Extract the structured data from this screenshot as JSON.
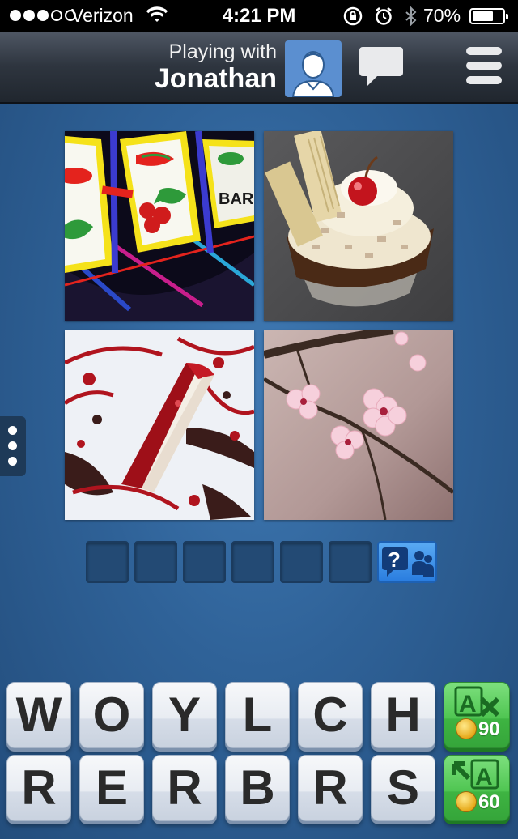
{
  "status_bar": {
    "carrier": "Verizon",
    "signal_bars_filled": 3,
    "signal_bars_total": 5,
    "time": "4:21 PM",
    "battery_percent": "70%",
    "battery_level": 0.7
  },
  "header": {
    "playing_with_label": "Playing with",
    "player_name": "Jonathan",
    "icons": [
      "avatar",
      "chat-icon",
      "menu-icon"
    ]
  },
  "puzzle": {
    "pictures": [
      {
        "subject": "slot-machine",
        "colors": [
          "#0c0a1a",
          "#f5e21a",
          "#e4231d",
          "#2e9a3a"
        ]
      },
      {
        "subject": "ice-cream-sundae",
        "colors": [
          "#4e4e50",
          "#efe6cf",
          "#c3141d",
          "#4a2a16"
        ]
      },
      {
        "subject": "cheesecake-slice",
        "colors": [
          "#f2f4f8",
          "#b0141e",
          "#3a1c1a"
        ]
      },
      {
        "subject": "cherry-blossom-branch",
        "colors": [
          "#b9a2a0",
          "#f6d0dc",
          "#3a2a22"
        ]
      }
    ],
    "answer_slots": 6,
    "help_button_icons": [
      "question-icon",
      "friends-icon"
    ]
  },
  "letters": {
    "row1": [
      "W",
      "O",
      "Y",
      "L",
      "C",
      "H"
    ],
    "row2": [
      "R",
      "E",
      "R",
      "B",
      "R",
      "S"
    ]
  },
  "powerups": [
    {
      "name": "remove-letters",
      "glyph": "A",
      "cost": "90"
    },
    {
      "name": "reveal-letter",
      "glyph": "A",
      "cost": "60"
    }
  ],
  "colors": {
    "background": "#2f6298",
    "tile": "#e8ecf2",
    "powerup": "#4fc552",
    "help": "#2a7ddf"
  }
}
